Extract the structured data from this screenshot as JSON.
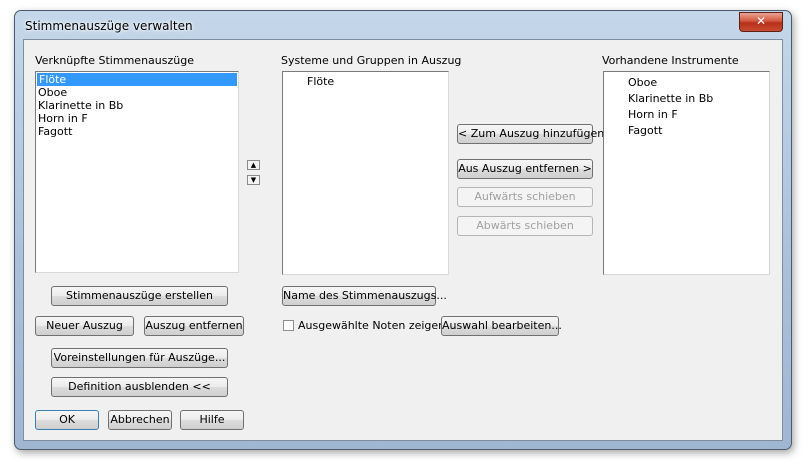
{
  "window": {
    "title": "Stimmenauszüge verwalten",
    "close_glyph": "✕"
  },
  "linked": {
    "label": "Verknüpfte Stimmenauszüge",
    "items": [
      "Flöte",
      "Oboe",
      "Klarinette in Bb",
      "Horn in F",
      "Fagott"
    ],
    "selected_index": 0
  },
  "systems": {
    "label": "Systeme und Gruppen in Auszug",
    "items": [
      "Flöte"
    ]
  },
  "available": {
    "label": "Vorhandene Instrumente",
    "items": [
      "Oboe",
      "Klarinette in Bb",
      "Horn in F",
      "Fagott"
    ]
  },
  "move_up_glyph": "▲",
  "move_down_glyph": "▼",
  "buttons": {
    "add_to_part": "< Zum Auszug hinzufügen",
    "remove_from_part": "Aus Auszug entfernen >",
    "move_up": "Aufwärts schieben",
    "move_down": "Abwärts schieben",
    "create_parts": "Stimmenauszüge erstellen",
    "part_name": "Name des Stimmenauszugs...",
    "new_part": "Neuer Auszug",
    "remove_part": "Auszug entfernen",
    "edit_selection": "Auswahl bearbeiten...",
    "part_settings": "Voreinstellungen für Auszüge...",
    "hide_definition": "Definition ausblenden <<",
    "ok": "OK",
    "cancel": "Abbrechen",
    "help": "Hilfe"
  },
  "show_selected_notes": {
    "label": "Ausgewählte Noten zeigen",
    "checked": false
  }
}
